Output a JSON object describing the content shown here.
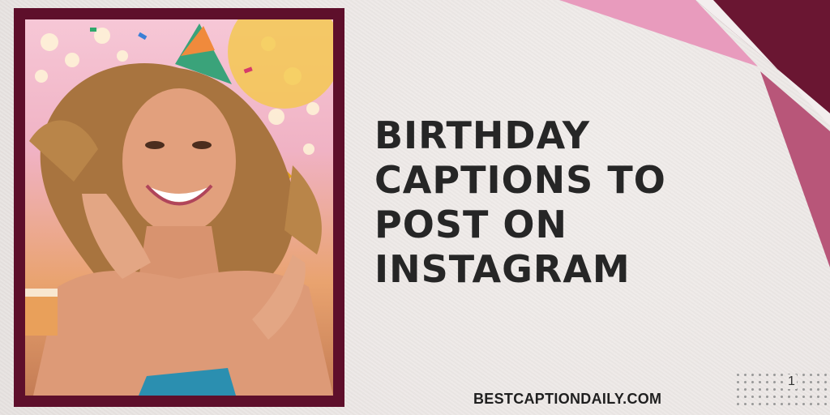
{
  "headline": {
    "line1": "BIRTHDAY",
    "line2": "CAPTIONS TO",
    "line3": "POST ON",
    "line4": "INSTAGRAM"
  },
  "website": "BESTCAPTIONDAILY.COM",
  "page_number": "1",
  "colors": {
    "frame": "#5e0f2b",
    "accent_pink": "#e89bbd",
    "accent_maroon": "#6a1632",
    "text": "#262626",
    "background": "#ece8e6"
  }
}
